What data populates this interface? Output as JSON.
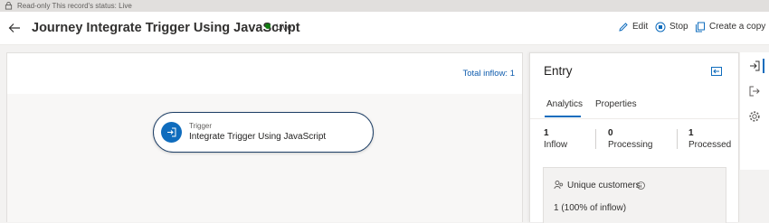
{
  "status_bar": {
    "text": "Read-only This record's status: Live"
  },
  "header": {
    "title": "Journey Integrate Trigger Using JavaScript",
    "status": "Live",
    "actions": {
      "edit": "Edit",
      "stop": "Stop",
      "copy": "Create a copy"
    }
  },
  "canvas": {
    "total_inflow": "Total inflow: 1",
    "node": {
      "kind": "Trigger",
      "name": "Integrate Trigger Using JavaScript"
    }
  },
  "panel": {
    "title": "Entry",
    "tabs": [
      "Analytics",
      "Properties"
    ],
    "active_tab": "Analytics",
    "metrics": [
      {
        "value": "1",
        "label": "Inflow"
      },
      {
        "value": "0",
        "label": "Processing"
      },
      {
        "value": "1",
        "label": "Processed"
      }
    ],
    "card": {
      "title": "Unique customers",
      "value": "1 (100% of inflow)"
    }
  },
  "colors": {
    "accent": "#0f6cbd",
    "live_dot": "#107c10",
    "node_border": "#1e3f66"
  }
}
